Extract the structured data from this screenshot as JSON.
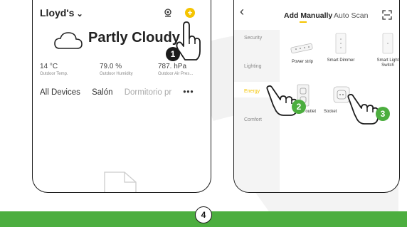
{
  "screen1": {
    "home_name": "Lloyd's",
    "weather_title": "Partly Cloudy",
    "stats": [
      {
        "value": "14 °C",
        "label": "Outdoor Temp."
      },
      {
        "value": "79.0 %",
        "label": "Outdoor Humidity"
      },
      {
        "value": "787. hPa",
        "label": "Outdoor Air Pres..."
      }
    ],
    "tabs": [
      "All Devices",
      "Salón",
      "Dormitorio pr"
    ],
    "more": "•••",
    "badge": "1"
  },
  "screen2": {
    "tab_active": "Add Manually",
    "tab_inactive": "Auto Scan",
    "categories": [
      "Security",
      "Lighting",
      "Energy",
      "Comfort"
    ],
    "devices": [
      {
        "label": "Power strip"
      },
      {
        "label": "Smart Dimmer"
      },
      {
        "label": "Smart Light Switch"
      },
      {
        "label": "Wall outlet"
      },
      {
        "label": "Socket"
      }
    ],
    "badges": [
      "2",
      "3"
    ]
  },
  "step": "4",
  "colors": {
    "accent": "#f5c400",
    "green": "#4cae3f",
    "outline": "#1c1c1c"
  }
}
